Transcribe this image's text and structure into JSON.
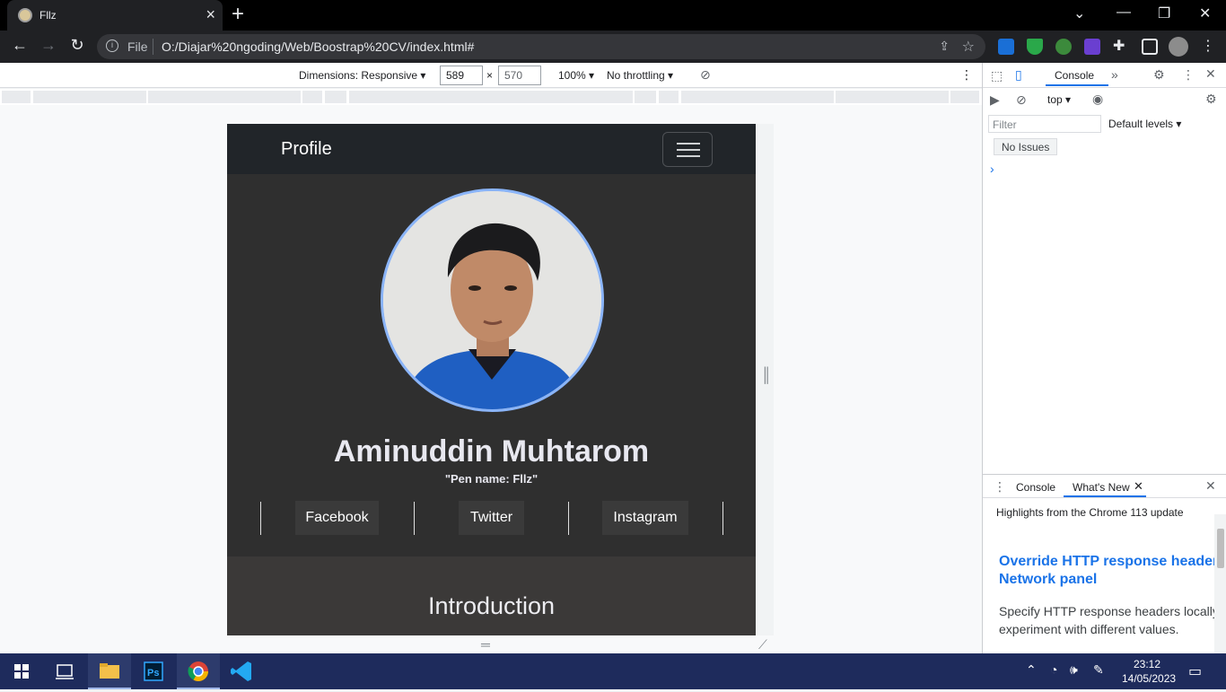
{
  "browser": {
    "tab_title": "Fllz",
    "url_scheme_label": "File",
    "url": "O:/Diajar%20ngoding/Web/Boostrap%20CV/index.html#"
  },
  "device_toolbar": {
    "dimensions_label": "Dimensions: Responsive",
    "width": "589",
    "height": "570",
    "times": "×",
    "zoom": "100%",
    "throttling": "No throttling"
  },
  "site": {
    "brand": "Profile",
    "name": "Aminuddin Muhtarom",
    "pen_name": "\"Pen name: Fllz\"",
    "social": [
      "Facebook",
      "Twitter",
      "Instagram"
    ],
    "intro_title": "Introduction"
  },
  "devtools": {
    "tab_console": "Console",
    "context": "top",
    "filter_placeholder": "Filter",
    "levels": "Default levels",
    "issues": "No Issues",
    "drawer_tab_console": "Console",
    "drawer_tab_whatsnew": "What's New",
    "highlights": "Highlights from the Chrome 113 update",
    "whatsnew_title_line1": "Override HTTP response headers in the",
    "whatsnew_title_line2": "Network panel",
    "whatsnew_desc_line1": "Specify HTTP response headers locally to",
    "whatsnew_desc_line2": "experiment with different values."
  },
  "taskbar": {
    "time": "23:12",
    "date": "14/05/2023"
  }
}
